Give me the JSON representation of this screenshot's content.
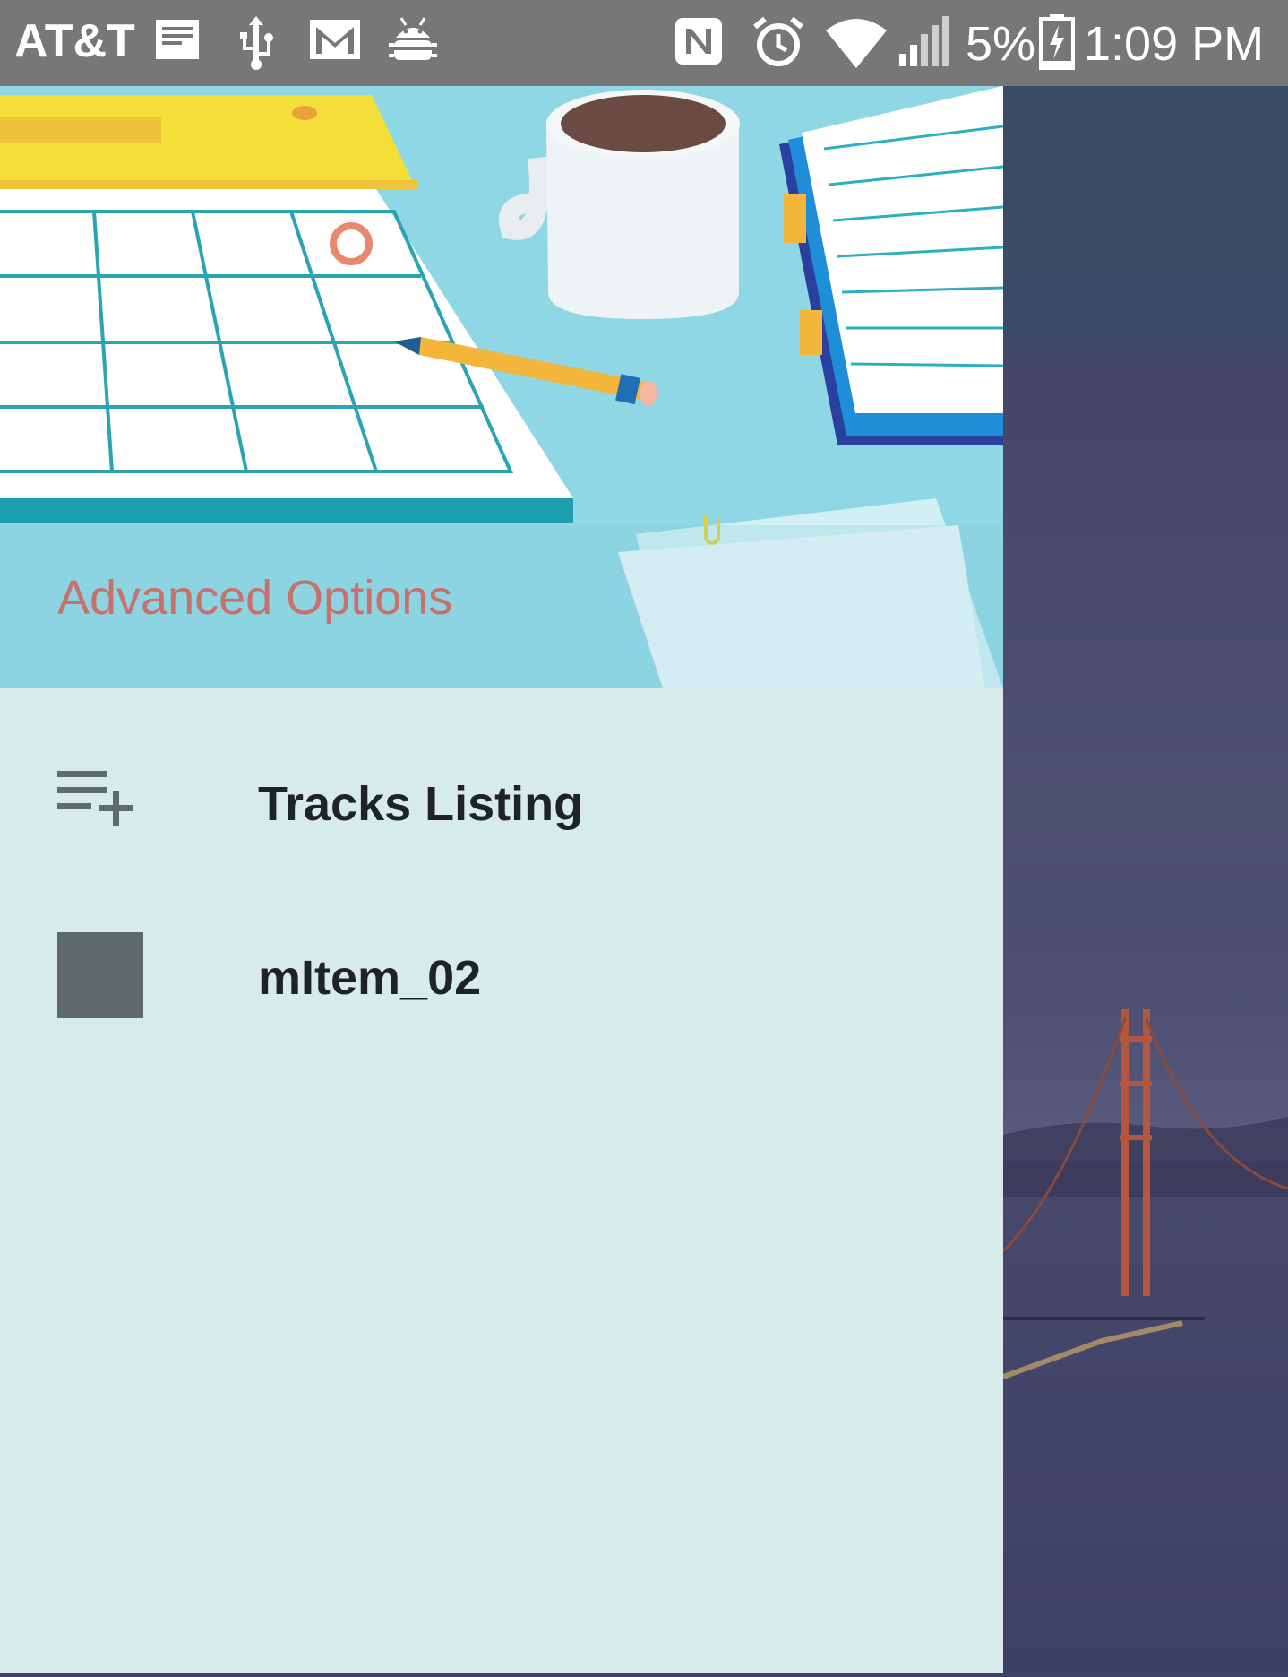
{
  "status_bar": {
    "carrier": "AT&T",
    "battery_percent": "5%",
    "time": "1:09 PM",
    "icons": [
      "notes-icon",
      "usb-icon",
      "gmail-icon",
      "android-debug-icon",
      "nfc-icon",
      "alarm-icon",
      "wifi-icon",
      "signal-icon",
      "battery-charging-icon"
    ]
  },
  "drawer": {
    "header_title": "Advanced Options",
    "items": [
      {
        "label": "Tracks Listing",
        "icon": "playlist-add-icon"
      },
      {
        "label": "mItem_02",
        "icon": "placeholder-square-icon"
      }
    ]
  },
  "colors": {
    "status_bar": "#777777",
    "drawer_bg": "#d7ebeb",
    "header_title": "#c9706b",
    "item_text": "#1e2325",
    "icon_gray": "#5f6a6b"
  }
}
